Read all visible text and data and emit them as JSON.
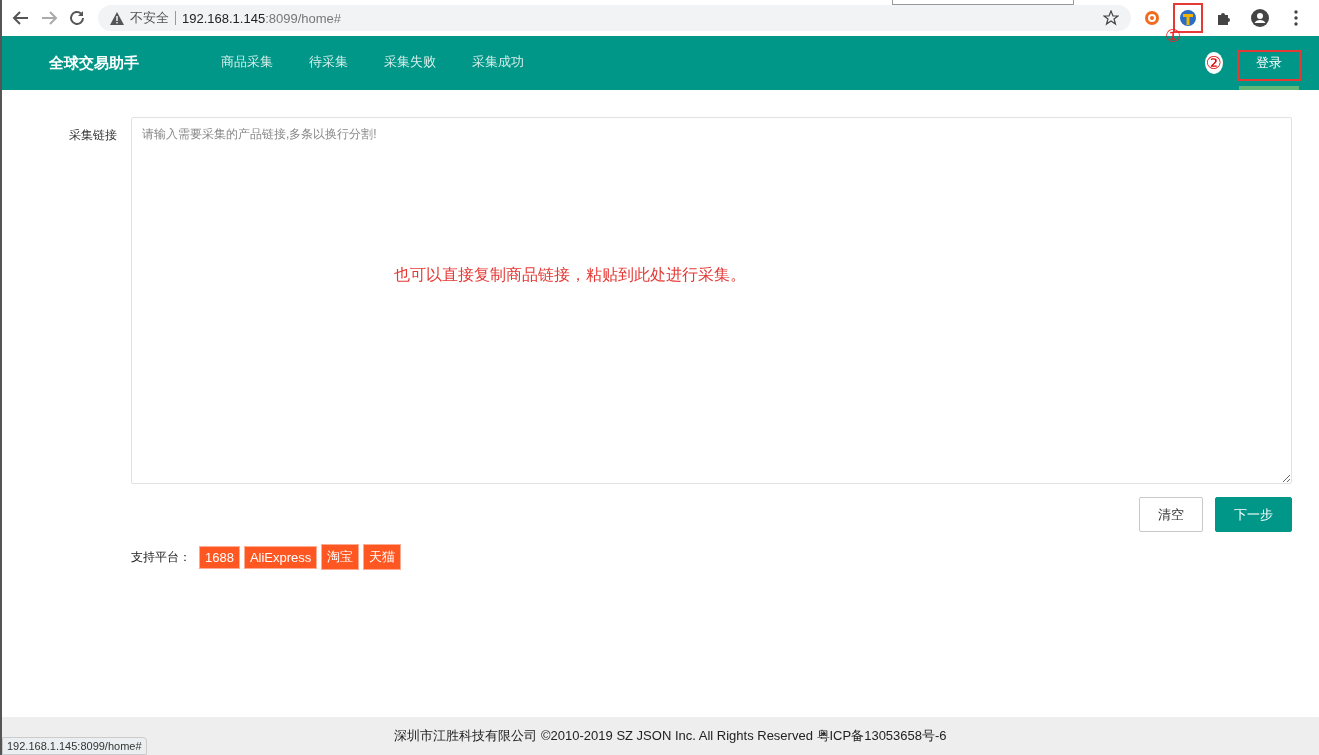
{
  "browser": {
    "security_label": "不安全",
    "url_host": "192.168.1.145",
    "url_path": ":8099/home#",
    "status_url": "192.168.1.145:8099/home#"
  },
  "header": {
    "brand": "全球交易助手",
    "nav": [
      {
        "label": "商品采集",
        "selected": false
      },
      {
        "label": "待采集",
        "selected": false
      },
      {
        "label": "采集失败",
        "selected": false
      },
      {
        "label": "采集成功",
        "selected": false
      }
    ],
    "login": {
      "label": "登录",
      "selected": true
    }
  },
  "annotations": {
    "marker_1": "①",
    "marker_2": "②",
    "note": "也可以直接复制商品链接，粘贴到此处进行采集。"
  },
  "form": {
    "label": "采集链接",
    "placeholder": "请输入需要采集的产品链接,多条以换行分割!",
    "buttons": [
      {
        "label": "清空",
        "kind": "secondary"
      },
      {
        "label": "下一步",
        "kind": "primary"
      }
    ],
    "platforms_label": "支持平台：",
    "platforms": [
      "1688",
      "AliExpress",
      "淘宝",
      "天猫"
    ]
  },
  "footer": "深圳市江胜科技有限公司 ©2010-2019 SZ JSON Inc. All Rights Reserved 粤ICP备13053658号-6"
}
